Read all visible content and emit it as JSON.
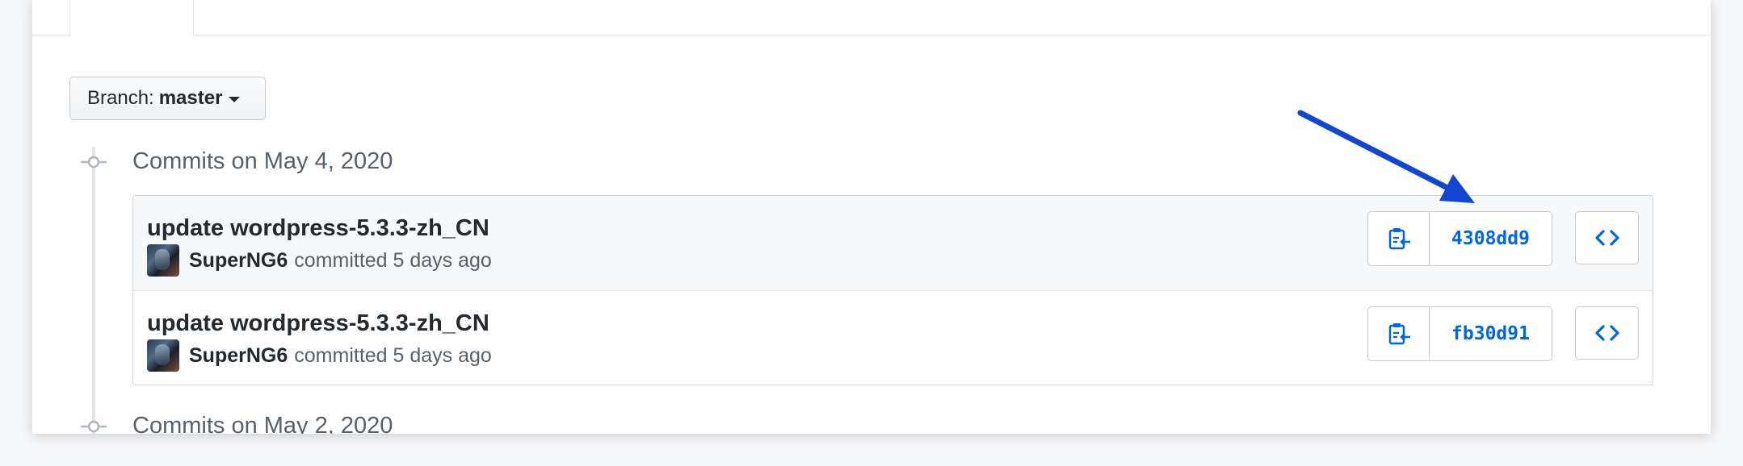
{
  "branch_selector": {
    "prefix": "Branch:",
    "name": "master"
  },
  "commit_groups": [
    {
      "title": "Commits on May 4, 2020",
      "commits": [
        {
          "message": "update wordpress-5.3.3-zh_CN",
          "author": "SuperNG6",
          "action": "committed 5 days ago",
          "sha": "4308dd9"
        },
        {
          "message": "update wordpress-5.3.3-zh_CN",
          "author": "SuperNG6",
          "action": "committed 5 days ago",
          "sha": "fb30d91"
        }
      ]
    },
    {
      "title": "Commits on May 2, 2020"
    }
  ],
  "colors": {
    "link_blue": "#0366d6",
    "annotation_arrow": "#1246d1"
  },
  "icons": {
    "copy": "clippy-icon",
    "browse": "code-brackets-icon",
    "timeline": "commit-node-icon"
  }
}
